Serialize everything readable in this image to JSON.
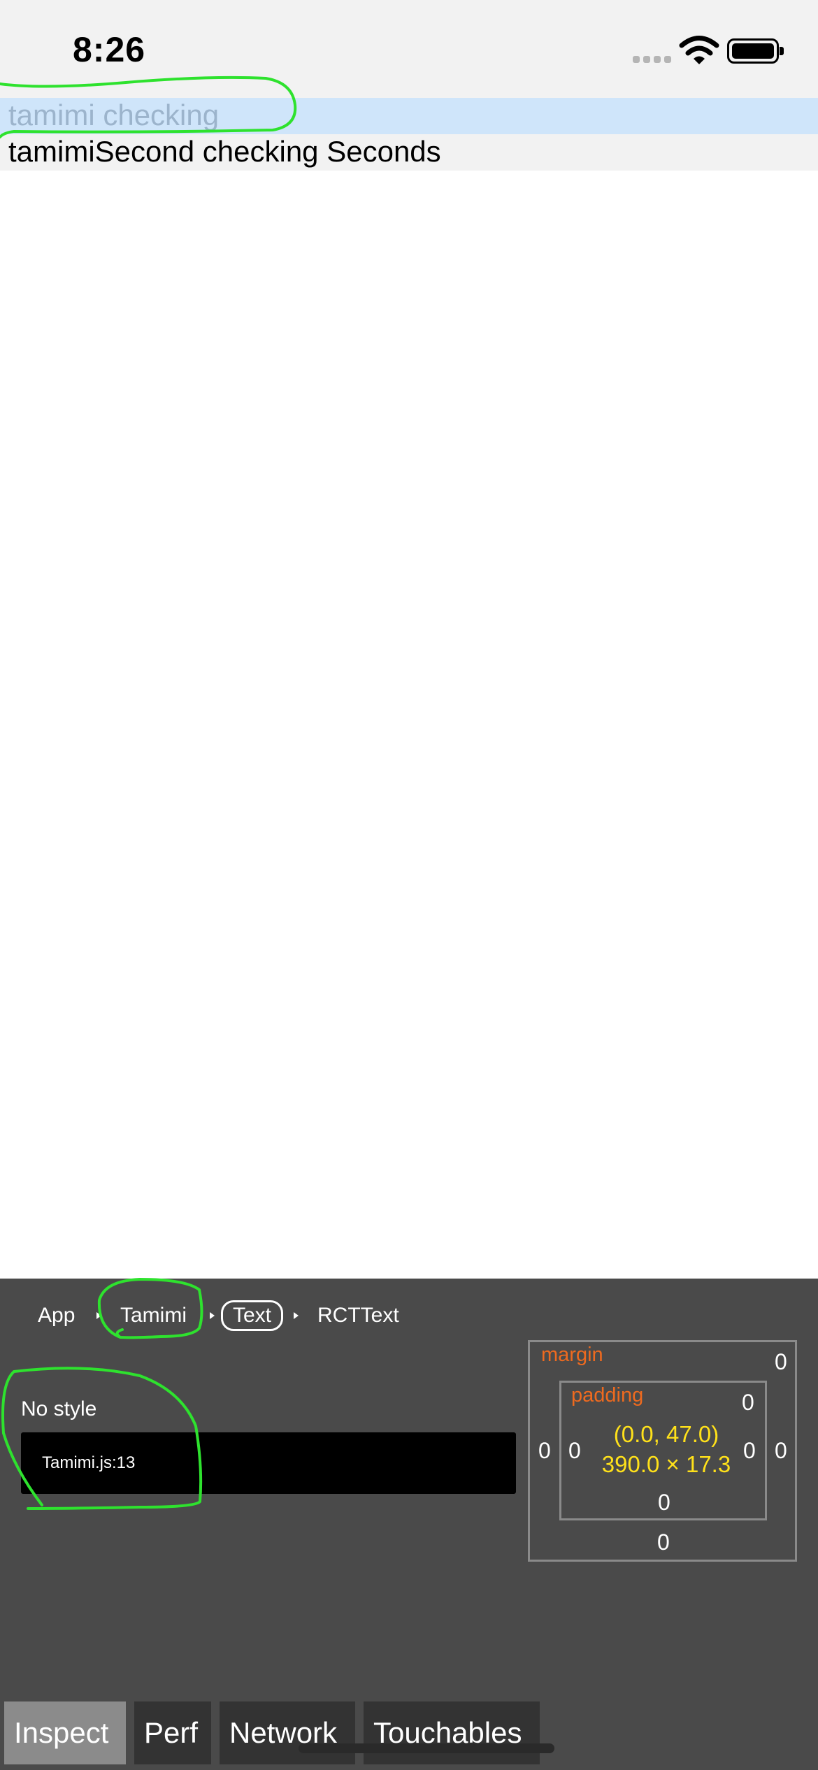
{
  "status_bar": {
    "time": "8:26"
  },
  "list": {
    "rows": [
      {
        "text": "tamimi checking"
      },
      {
        "text": "tamimiSecond checking Seconds"
      }
    ]
  },
  "inspector": {
    "breadcrumbs": [
      "App",
      "Tamimi",
      "Text",
      "RCTText"
    ],
    "style_label": "No style",
    "source_location": "Tamimi.js:13",
    "box_model": {
      "margin_label": "margin",
      "padding_label": "padding",
      "margin": {
        "top": "0",
        "right": "0",
        "bottom": "0",
        "left": "0"
      },
      "padding": {
        "top": "0",
        "right": "0",
        "bottom": "0",
        "left": "0"
      },
      "position": "(0.0, 47.0)",
      "size": "390.0 × 17.3"
    },
    "tabs": [
      {
        "label": "Inspect",
        "active": true
      },
      {
        "label": "Perf",
        "active": false
      },
      {
        "label": "Network",
        "active": false
      },
      {
        "label": "Touchables",
        "active": false
      }
    ]
  },
  "colors": {
    "highlight_row": "#cfe5fa",
    "annotation_stroke": "#2ee22e",
    "box_label": "#ee6a1f",
    "dimension_text": "#ffe11a"
  }
}
